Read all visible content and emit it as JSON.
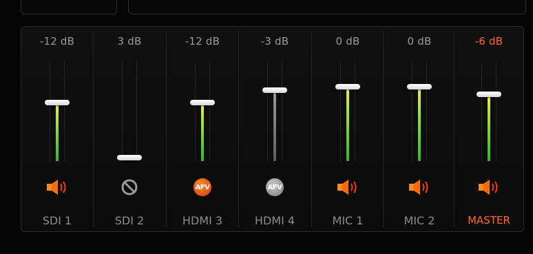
{
  "accent_color": "#ff6a1a",
  "channels": [
    {
      "name": "SDI 1",
      "db": "-12 dB",
      "level": 0.59,
      "state": "speaker",
      "fill": "green"
    },
    {
      "name": "SDI 2",
      "db": "3 dB",
      "level": 0.0,
      "state": "disabled",
      "fill": "none"
    },
    {
      "name": "HDMI 3",
      "db": "-12 dB",
      "level": 0.59,
      "state": "afv-on",
      "fill": "green",
      "icon_text": "AFV"
    },
    {
      "name": "HDMI 4",
      "db": "-3 dB",
      "level": 0.72,
      "state": "afv-off",
      "fill": "grey",
      "icon_text": "AFV"
    },
    {
      "name": "MIC 1",
      "db": "0 dB",
      "level": 0.76,
      "state": "speaker",
      "fill": "green"
    },
    {
      "name": "MIC 2",
      "db": "0 dB",
      "level": 0.76,
      "state": "speaker",
      "fill": "green"
    },
    {
      "name": "MASTER",
      "db": "-6 dB",
      "level": 0.68,
      "state": "speaker",
      "fill": "green",
      "master": true
    }
  ]
}
